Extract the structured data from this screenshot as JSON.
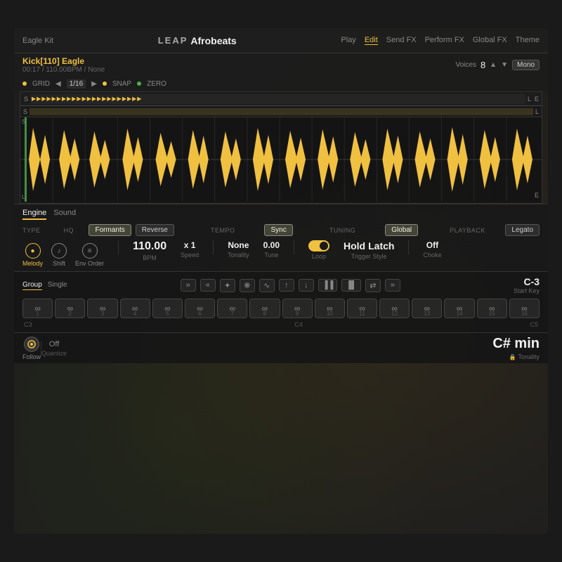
{
  "app": {
    "title": "LEAP",
    "subtitle": "Afrobeats",
    "preset": "Eagle Kit"
  },
  "nav": {
    "items": [
      "Play",
      "Edit",
      "Send FX",
      "Perform FX",
      "Global FX",
      "Theme"
    ],
    "active": "Edit"
  },
  "track": {
    "name": "Kick[110] Eagle",
    "time": "00:17",
    "bpm": "110.00BPM",
    "key": "None"
  },
  "voices": {
    "label": "Voices",
    "count": "8",
    "mode": "Mono"
  },
  "grid": {
    "grid_label": "GRID",
    "grid_value": "1/16",
    "snap_label": "SNAP",
    "zero_label": "ZERO"
  },
  "engine": {
    "tabs": [
      "Engine",
      "Sound"
    ],
    "active_tab": "Engine",
    "type_label": "TYPE",
    "hq_label": "HQ",
    "formants_label": "Formants",
    "reverse_label": "Reverse",
    "tempo_label": "TEMPO",
    "sync_label": "Sync",
    "tuning_label": "TUNING",
    "global_label": "Global",
    "playback_label": "PLAYBACK",
    "legato_label": "Legato",
    "bpm_value": "110.00",
    "bpm_sublabel": "BPM",
    "speed_value": "x 1",
    "speed_sublabel": "Speed",
    "tonality_value": "None",
    "tonality_sublabel": "Tonality",
    "tune_value": "0.00",
    "tune_sublabel": "Tune",
    "loop_sublabel": "Loop",
    "hold_label": "Hold",
    "latch_label": "Latch",
    "trigger_sublabel": "Trigger Style",
    "choke_value": "Off",
    "choke_sublabel": "Choke",
    "melody_label": "Melody",
    "shift_label": "Shift",
    "env_order_label": "Env Order"
  },
  "pads": {
    "group_tabs": [
      "Group",
      "Single"
    ],
    "active_tab": "Group",
    "controls": [
      "»",
      "«",
      "✦",
      "✦",
      "∿",
      "↑",
      "↓",
      "▐▐",
      "▐▌",
      "⇄",
      "»"
    ],
    "pads": [
      {
        "number": "1",
        "octave": "C3"
      },
      {
        "number": "2",
        "octave": ""
      },
      {
        "number": "3",
        "octave": ""
      },
      {
        "number": "4",
        "octave": "C4"
      },
      {
        "number": "5",
        "octave": ""
      },
      {
        "number": "6",
        "octave": ""
      },
      {
        "number": "7",
        "octave": ""
      },
      {
        "number": "8",
        "octave": ""
      },
      {
        "number": "9",
        "octave": ""
      },
      {
        "number": "10",
        "octave": ""
      },
      {
        "number": "11",
        "octave": ""
      },
      {
        "number": "12",
        "octave": ""
      },
      {
        "number": "13",
        "octave": ""
      },
      {
        "number": "14",
        "octave": ""
      },
      {
        "number": "15",
        "octave": ""
      },
      {
        "number": "16",
        "octave": "C5"
      }
    ],
    "c3_label": "C3",
    "c4_label": "C4",
    "c5_label": "C5"
  },
  "follow": {
    "label": "Follow"
  },
  "quantize": {
    "value": "Off",
    "label": "Quantize"
  },
  "start_key": {
    "value": "C-3",
    "label": "Start Key"
  },
  "tonality_display": {
    "value": "C# min",
    "sublabel": "Tonality"
  },
  "colors": {
    "accent": "#f0c040",
    "bg": "#1e1e1e",
    "text": "#f0f0f0",
    "dim": "#666666"
  }
}
